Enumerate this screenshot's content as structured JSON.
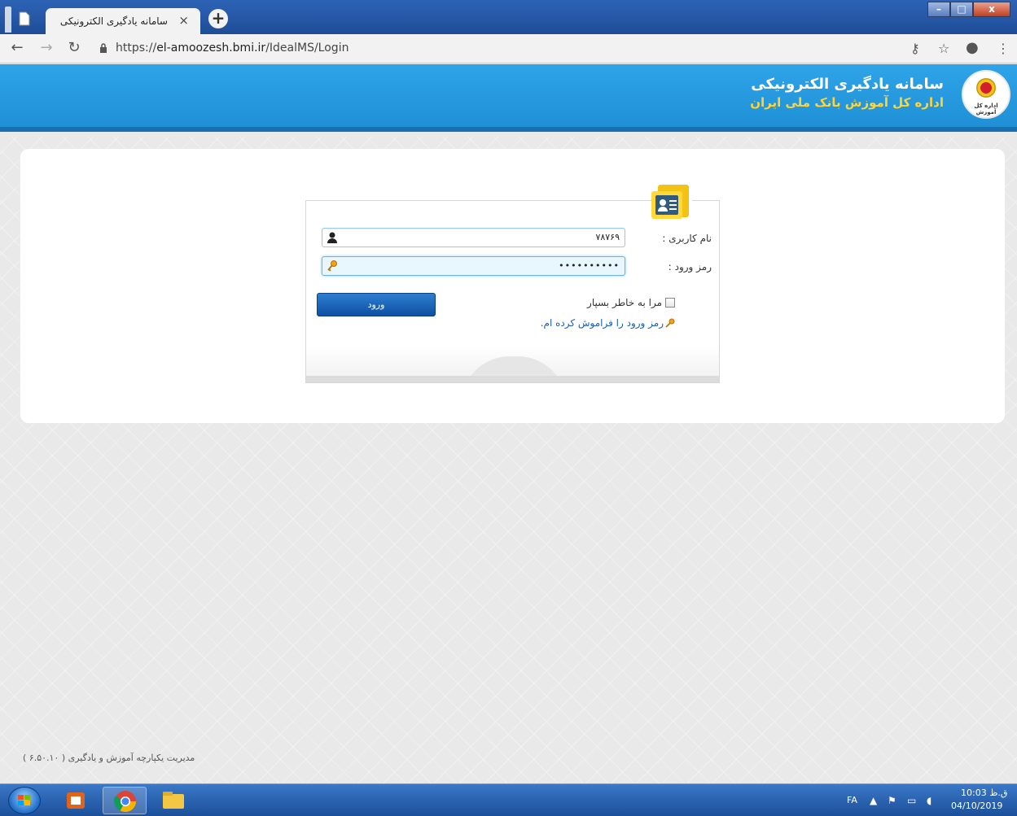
{
  "browser": {
    "tab_title": "سامانه یادگیری الکترونیکی",
    "tab_close": "×",
    "new_tab": "+",
    "url_prefix": "https://",
    "url_host": "el-amoozesh.bmi.ir",
    "url_path": "/IdealMS/Login",
    "window_controls": {
      "minimize": "–",
      "maximize": "□",
      "close": "x"
    }
  },
  "header": {
    "title": "سامانه یادگیری الکترونیکی",
    "subtitle": "اداره کل آموزش بانک ملی ایران",
    "logo_text": "اداره کل آموزش"
  },
  "login": {
    "username_label": "نام کاربری :",
    "username_value": "۷۸۷۶۹",
    "password_label": "رمز ورود :",
    "password_value": "••••••••••",
    "remember_label": "مرا به خاطر بسپار",
    "remember_checked": false,
    "forgot_label": "رمز ورود را فراموش کرده ام.",
    "submit_label": "ورود"
  },
  "footer": {
    "text": "مدیریت یکپارچه آموزش و یادگیری ( ۶.۵۰.۱۰ )"
  },
  "taskbar": {
    "lang": "FA",
    "time": "10:03 ق.ظ",
    "date": "04/10/2019"
  },
  "colors": {
    "header_blue": "#2fa4e8",
    "subtitle_yellow": "#ffd43a",
    "button_blue": "#0f4fa3",
    "link_blue": "#1b5fae"
  }
}
